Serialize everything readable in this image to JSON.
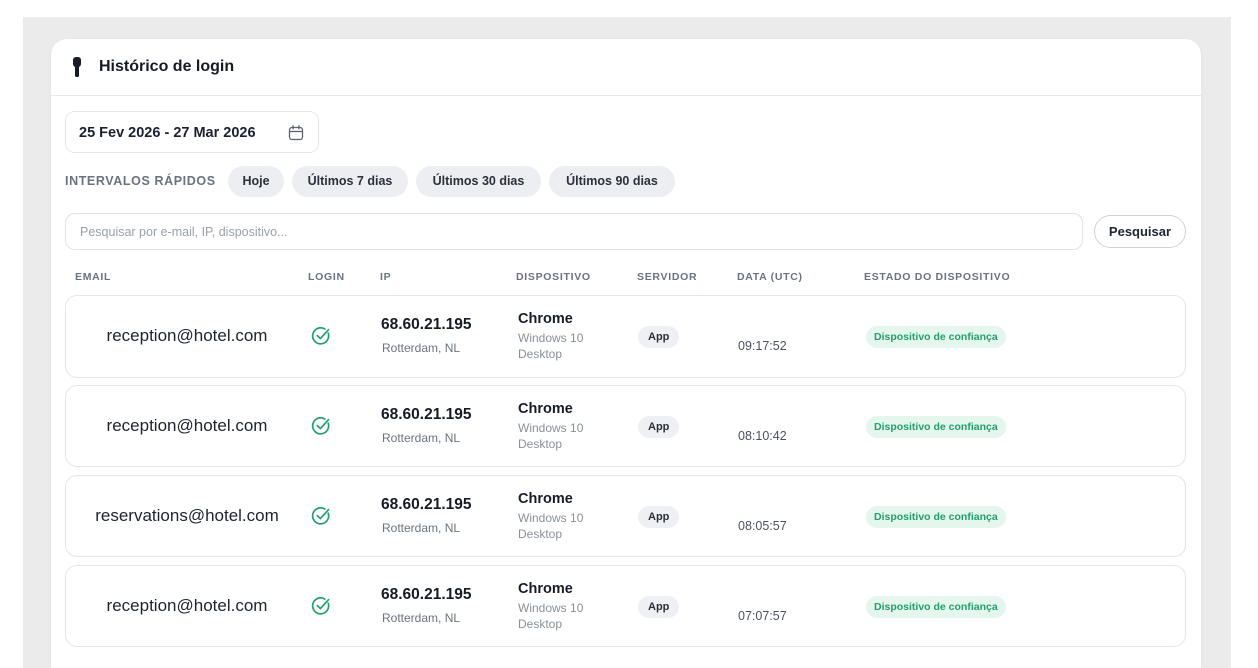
{
  "header": {
    "title": "Histórico de login"
  },
  "date_range": {
    "label": "25 Fev 2026 - 27 Mar 2026"
  },
  "quick_ranges": {
    "label": "INTERVALOS RÁPIDOS",
    "options": [
      "Hoje",
      "Últimos 7 dias",
      "Últimos 30 dias",
      "Últimos 90 dias"
    ]
  },
  "search": {
    "placeholder": "Pesquisar por e-mail, IP, dispositivo...",
    "value": "",
    "button_label": "Pesquisar"
  },
  "table": {
    "columns": [
      "EMAIL",
      "LOGIN",
      "IP",
      "DISPOSITIVO",
      "SERVIDOR",
      "DATA (UTC)",
      "ESTADO DO DISPOSITIVO"
    ],
    "rows": [
      {
        "email": "reception@hotel.com",
        "login_success": true,
        "ip": "68.60.21.195",
        "location": "Rotterdam, NL",
        "browser": "Chrome",
        "os": "Windows 10",
        "device_type": "Desktop",
        "server": "App",
        "time": "09:17:52",
        "status": "Dispositivo de confiança"
      },
      {
        "email": "reception@hotel.com",
        "login_success": true,
        "ip": "68.60.21.195",
        "location": "Rotterdam, NL",
        "browser": "Chrome",
        "os": "Windows 10",
        "device_type": "Desktop",
        "server": "App",
        "time": "08:10:42",
        "status": "Dispositivo de confiança"
      },
      {
        "email": "reservations@hotel.com",
        "login_success": true,
        "ip": "68.60.21.195",
        "location": "Rotterdam, NL",
        "browser": "Chrome",
        "os": "Windows 10",
        "device_type": "Desktop",
        "server": "App",
        "time": "08:05:57",
        "status": "Dispositivo de confiança"
      },
      {
        "email": "reception@hotel.com",
        "login_success": true,
        "ip": "68.60.21.195",
        "location": "Rotterdam, NL",
        "browser": "Chrome",
        "os": "Windows 10",
        "device_type": "Desktop",
        "server": "App",
        "time": "07:07:57",
        "status": "Dispositivo de confiança"
      }
    ]
  },
  "colors": {
    "success": "#22a06b",
    "status_bg": "#e5f6ee",
    "chip_bg": "#eceef2",
    "page_bg": "#ebebeb"
  }
}
